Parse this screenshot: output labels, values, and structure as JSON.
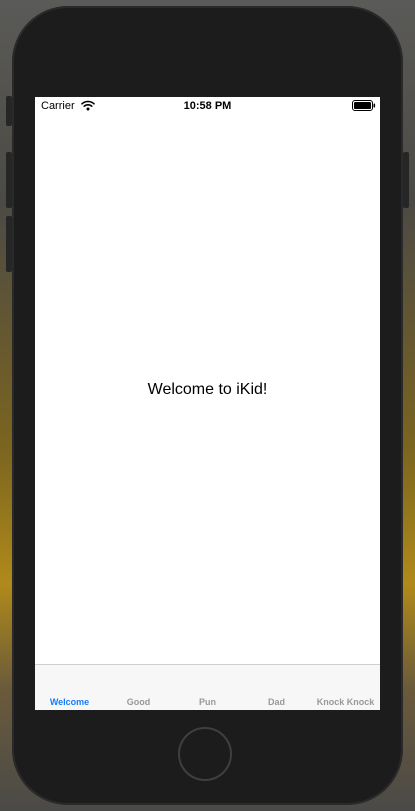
{
  "status_bar": {
    "carrier": "Carrier",
    "time": "10:58 PM"
  },
  "main": {
    "welcome_text": "Welcome to iKid!"
  },
  "tab_bar": {
    "active_index": 0,
    "tabs": [
      {
        "label": "Welcome"
      },
      {
        "label": "Good"
      },
      {
        "label": "Pun"
      },
      {
        "label": "Dad"
      },
      {
        "label": "Knock Knock"
      }
    ]
  },
  "colors": {
    "accent": "#147efb",
    "inactive_tab": "#999999",
    "device_body": "#1c1c1c"
  },
  "icons": [
    "wifi-icon",
    "battery-icon"
  ]
}
